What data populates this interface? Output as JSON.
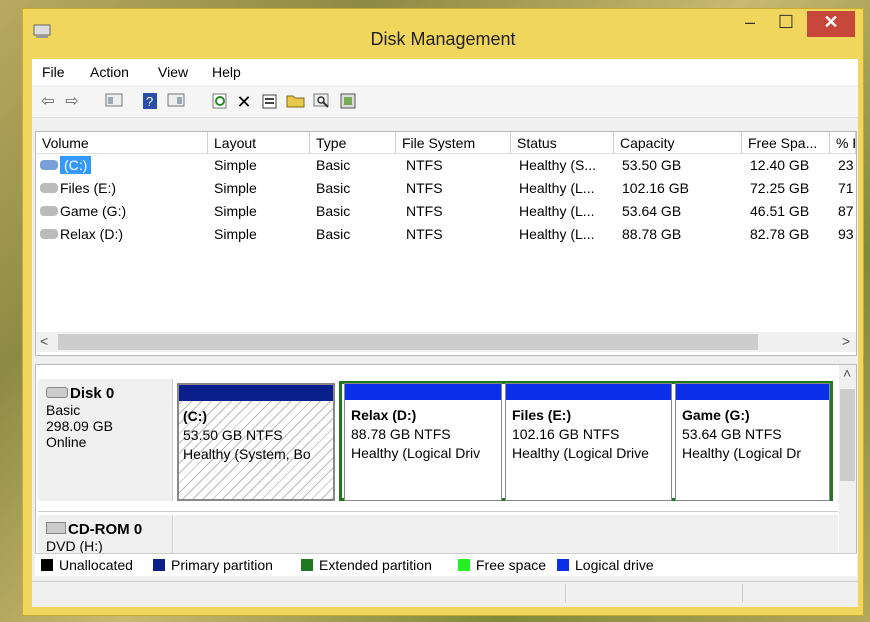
{
  "window": {
    "title": "Disk Management"
  },
  "menu": [
    "File",
    "Action",
    "View",
    "Help"
  ],
  "toolbar_icons": [
    "back-icon",
    "forward-icon",
    "console-icon",
    "help-icon",
    "view-icon",
    "refresh-icon",
    "delete-icon",
    "properties-icon",
    "open-icon",
    "search-icon",
    "settings-icon"
  ],
  "volume_table": {
    "headers": [
      "Volume",
      "Layout",
      "Type",
      "File System",
      "Status",
      "Capacity",
      "Free Spa...",
      "% F"
    ],
    "rows": [
      {
        "volume": "(C:)",
        "layout": "Simple",
        "type": "Basic",
        "fs": "NTFS",
        "status": "Healthy (S...",
        "capacity": "53.50 GB",
        "free": "12.40 GB",
        "pct": "23"
      },
      {
        "volume": "Files (E:)",
        "layout": "Simple",
        "type": "Basic",
        "fs": "NTFS",
        "status": "Healthy (L...",
        "capacity": "102.16 GB",
        "free": "72.25 GB",
        "pct": "71"
      },
      {
        "volume": "Game (G:)",
        "layout": "Simple",
        "type": "Basic",
        "fs": "NTFS",
        "status": "Healthy (L...",
        "capacity": "53.64 GB",
        "free": "46.51 GB",
        "pct": "87"
      },
      {
        "volume": "Relax (D:)",
        "layout": "Simple",
        "type": "Basic",
        "fs": "NTFS",
        "status": "Healthy (L...",
        "capacity": "88.78 GB",
        "free": "82.78 GB",
        "pct": "93"
      }
    ]
  },
  "disk0": {
    "name": "Disk 0",
    "type": "Basic",
    "size": "298.09 GB",
    "state": "Online",
    "partitions": [
      {
        "name": "(C:)",
        "size": "53.50 GB NTFS",
        "status": "Healthy (System, Bo"
      },
      {
        "name": "Relax  (D:)",
        "size": "88.78 GB NTFS",
        "status": "Healthy (Logical Driv"
      },
      {
        "name": "Files  (E:)",
        "size": "102.16 GB NTFS",
        "status": "Healthy (Logical Drive"
      },
      {
        "name": "Game  (G:)",
        "size": "53.64 GB NTFS",
        "status": "Healthy (Logical Dr"
      }
    ]
  },
  "cdrom0": {
    "name": "CD-ROM 0",
    "drive": "DVD (H:)"
  },
  "legend": [
    {
      "label": "Unallocated",
      "color": "#000000"
    },
    {
      "label": "Primary partition",
      "color": "#0a1f8c"
    },
    {
      "label": "Extended partition",
      "color": "#1f7a1f"
    },
    {
      "label": "Free space",
      "color": "#22ee22"
    },
    {
      "label": "Logical drive",
      "color": "#0b2ee8"
    }
  ],
  "colors": {
    "primary_bar": "#0a1f8c",
    "logical_bar": "#0b2ee8",
    "extended_border": "#1f7a1f",
    "selection": "#3399ff"
  }
}
